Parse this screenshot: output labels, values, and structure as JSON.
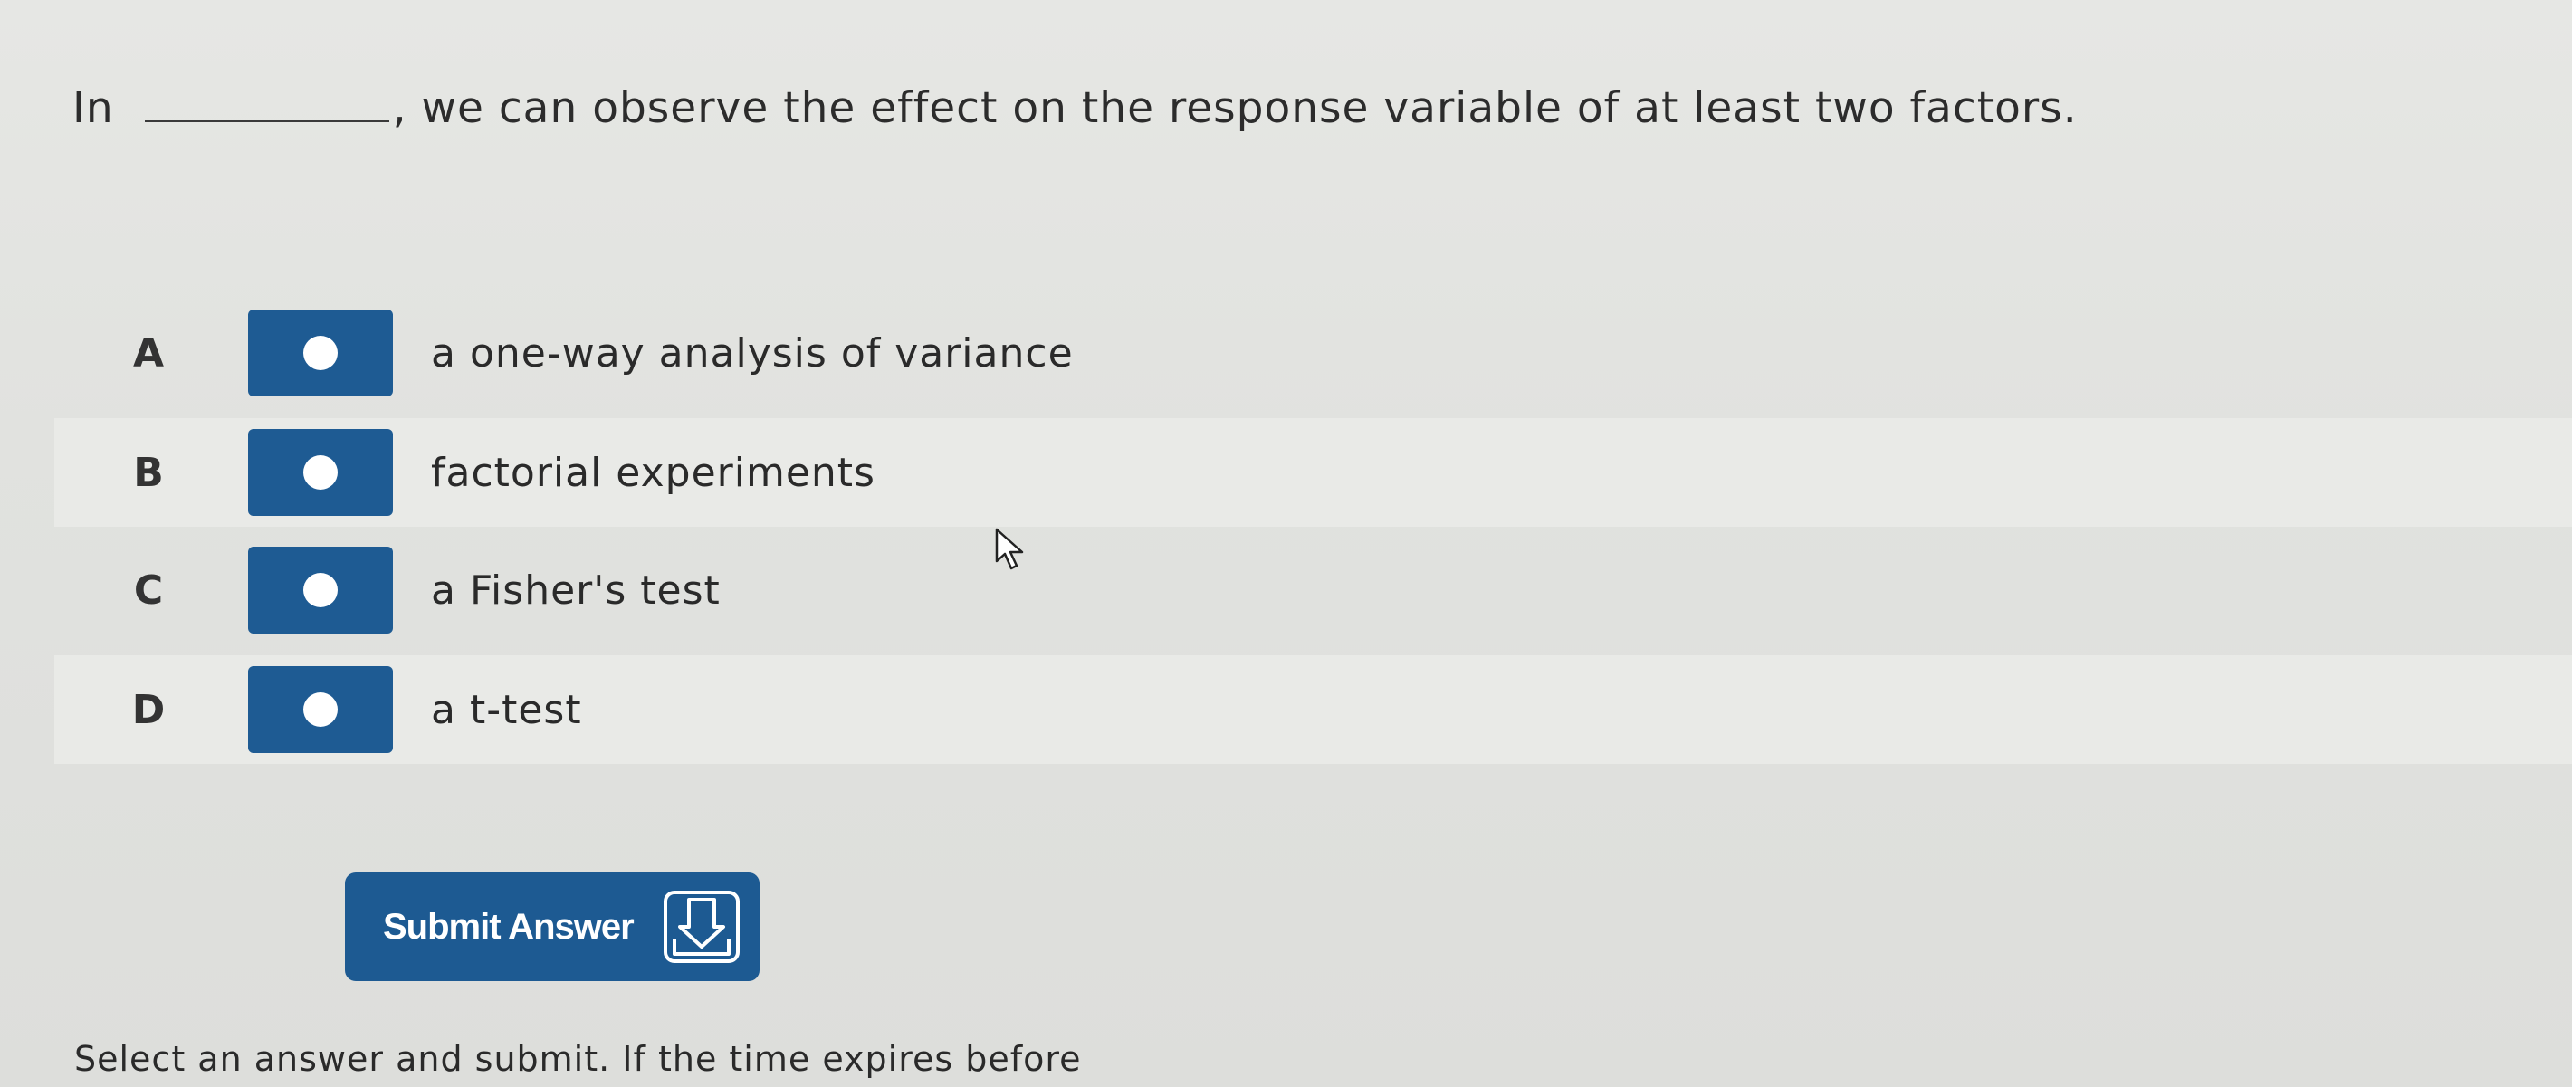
{
  "question": {
    "prefix": "In",
    "suffix": ", we can observe the effect on the response variable of at least two factors."
  },
  "options": [
    {
      "letter": "A",
      "text": "a one-way analysis of variance"
    },
    {
      "letter": "B",
      "text": "factorial experiments"
    },
    {
      "letter": "C",
      "text": "a Fisher's test"
    },
    {
      "letter": "D",
      "text": "a t-test"
    }
  ],
  "submit": {
    "label": "Submit Answer",
    "icon": "submit-tray-arrow-icon"
  },
  "footer": {
    "text": "Select an answer and submit. If the time expires before"
  },
  "colors": {
    "accent": "#1e5b93",
    "background": "#e3e4e1"
  }
}
